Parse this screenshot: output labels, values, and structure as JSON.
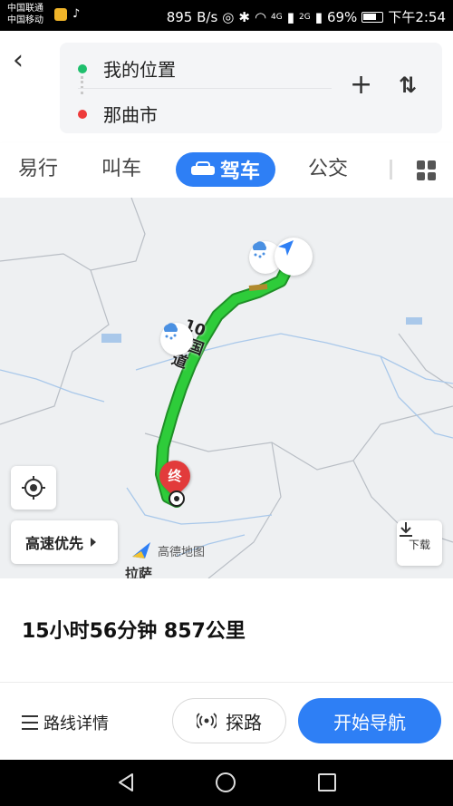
{
  "status_bar": {
    "carrier1": "中国联通",
    "carrier2": "中国移动",
    "speed": "895 B/s",
    "net1": "4G",
    "net2": "2G",
    "battery": "69%",
    "time": "下午2:54"
  },
  "route": {
    "origin": "我的位置",
    "destination": "那曲市"
  },
  "tabs": {
    "items": [
      "易行",
      "叫车",
      "驾车",
      "公交"
    ],
    "active": "驾车"
  },
  "map": {
    "road_label": "109国道",
    "end_marker": "终",
    "route_pref": "高速优先",
    "download_label": "下载",
    "logo_text": "高德地图",
    "city_label": "拉萨",
    "colors": {
      "route": "#2ecc3a",
      "route_outline": "#1f8f27",
      "accent": "#2e7ff5",
      "end_marker": "#e23b3b"
    }
  },
  "summary": {
    "duration_distance": "15小时56分钟  857公里"
  },
  "actions": {
    "details": "路线详情",
    "explore": "探路",
    "navigate": "开始导航"
  }
}
